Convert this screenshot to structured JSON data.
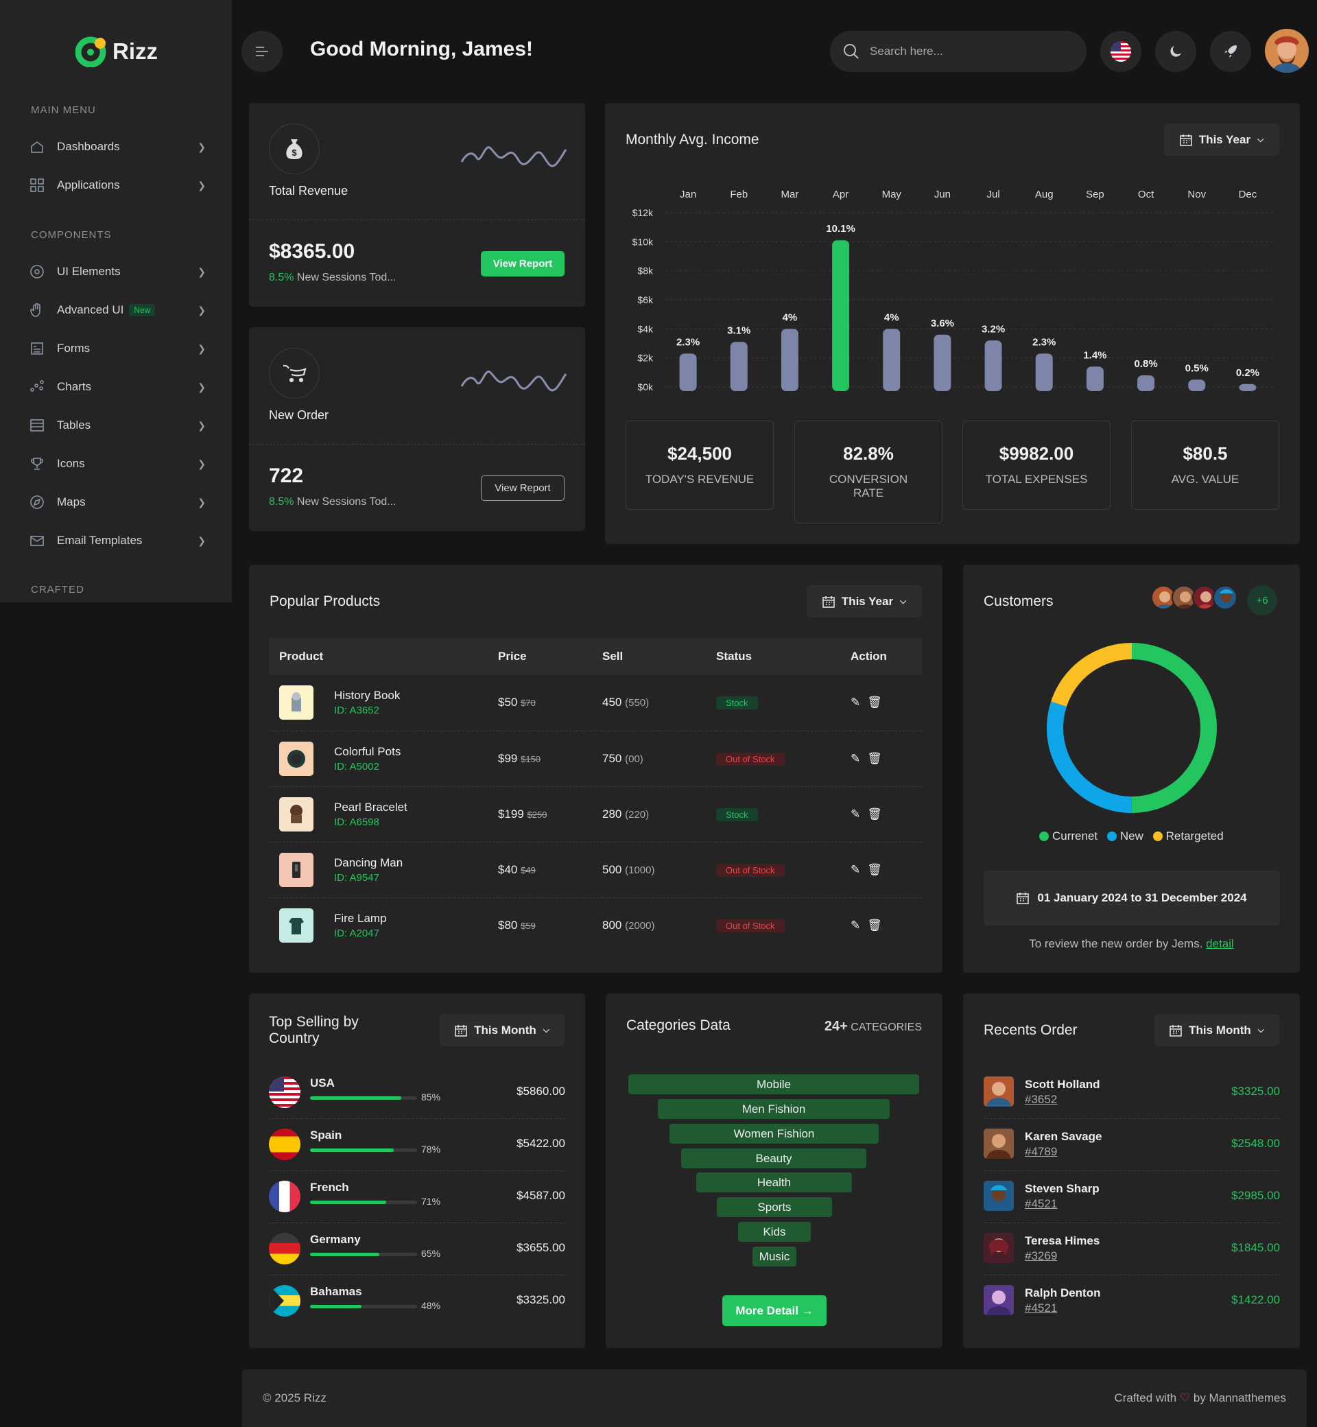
{
  "brand": {
    "name": "Rizz",
    "accent": "#22c55e"
  },
  "sidebar": {
    "main_heading": "Main Menu",
    "components_heading": "Components",
    "crafted_heading": "Crafted",
    "items": [
      {
        "label": "Dashboards",
        "icon": "home-icon"
      },
      {
        "label": "Applications",
        "icon": "grid-icon"
      },
      {
        "label": "UI Elements",
        "icon": "target-icon"
      },
      {
        "label": "Advanced UI",
        "icon": "hand-icon",
        "badge": "New"
      },
      {
        "label": "Forms",
        "icon": "form-icon"
      },
      {
        "label": "Charts",
        "icon": "chart-icon"
      },
      {
        "label": "Tables",
        "icon": "table-icon"
      },
      {
        "label": "Icons",
        "icon": "trophy-icon"
      },
      {
        "label": "Maps",
        "icon": "compass-icon"
      },
      {
        "label": "Email Templates",
        "icon": "mail-icon"
      }
    ]
  },
  "header": {
    "greeting": "Good Morning, James!",
    "search_placeholder": "Search here..."
  },
  "revenue_card": {
    "title": "Total Revenue",
    "value": "$8365.00",
    "pct": "8.5%",
    "sub": "New Sessions Tod...",
    "button": "View Report"
  },
  "order_card": {
    "title": "New Order",
    "value": "722",
    "pct": "8.5%",
    "sub": "New Sessions Tod...",
    "button": "View Report"
  },
  "income": {
    "title": "Monthly Avg. Income",
    "filter": "This Year",
    "stats": [
      {
        "value": "$24,500",
        "label": "Today's Revenue"
      },
      {
        "value": "82.8%",
        "label": "Conversion Rate"
      },
      {
        "value": "$9982.00",
        "label": "Total Expenses"
      },
      {
        "value": "$80.5",
        "label": "Avg. Value"
      }
    ]
  },
  "chart_data": {
    "type": "bar",
    "categories": [
      "Jan",
      "Feb",
      "Mar",
      "Apr",
      "May",
      "Jun",
      "Jul",
      "Aug",
      "Sep",
      "Oct",
      "Nov",
      "Dec"
    ],
    "values": [
      2300,
      3100,
      4000,
      10100,
      4000,
      3600,
      3200,
      2300,
      1400,
      800,
      500,
      200
    ],
    "labels": [
      "2.3%",
      "3.1%",
      "4%",
      "10.1%",
      "4%",
      "3.6%",
      "3.2%",
      "2.3%",
      "1.4%",
      "0.8%",
      "0.5%",
      "0.2%"
    ],
    "y_ticks": [
      "$12k",
      "$10k",
      "$8k",
      "$6k",
      "$4k",
      "$2k",
      "$0k"
    ],
    "ylim": [
      0,
      12000
    ],
    "highlight_index": 3,
    "colors": {
      "default": "#7d86a8",
      "highlight": "#22c55e"
    },
    "grid": true
  },
  "products": {
    "title": "Popular Products",
    "filter": "This Year",
    "columns": [
      "Product",
      "Price",
      "Sell",
      "Status",
      "Action"
    ],
    "rows": [
      {
        "name": "History Book",
        "id": "ID: A3652",
        "price": "$50",
        "old": "$70",
        "sell": "450",
        "sell_total": "(550)",
        "status": "Stock",
        "thumb_bg": "#fdf3c8"
      },
      {
        "name": "Colorful Pots",
        "id": "ID: A5002",
        "price": "$99",
        "old": "$150",
        "sell": "750",
        "sell_total": "(00)",
        "status": "Out of Stock",
        "thumb_bg": "#f8d2b0"
      },
      {
        "name": "Pearl Bracelet",
        "id": "ID: A6598",
        "price": "$199",
        "old": "$250",
        "sell": "280",
        "sell_total": "(220)",
        "status": "Stock",
        "thumb_bg": "#f5e2c8"
      },
      {
        "name": "Dancing Man",
        "id": "ID: A9547",
        "price": "$40",
        "old": "$49",
        "sell": "500",
        "sell_total": "(1000)",
        "status": "Out of Stock",
        "thumb_bg": "#f2c6b0"
      },
      {
        "name": "Fire Lamp",
        "id": "ID: A2047",
        "price": "$80",
        "old": "$59",
        "sell": "800",
        "sell_total": "(2000)",
        "status": "Out of Stock",
        "thumb_bg": "#c4ebe4"
      }
    ]
  },
  "customers": {
    "title": "Customers",
    "more": "+6",
    "legend": [
      {
        "label": "Currenet",
        "color": "#22c55e",
        "share": 0.5
      },
      {
        "label": "New",
        "color": "#0ea5e9",
        "share": 0.3
      },
      {
        "label": "Retargeted",
        "color": "#fbbf24",
        "share": 0.2
      }
    ],
    "date_range": "01 January 2024 to 31 December 2024",
    "note": "To review the new order by Jems.",
    "link": "detail"
  },
  "countries": {
    "title": "Top Selling by Country",
    "filter": "This Month",
    "rows": [
      {
        "name": "USA",
        "pct": "85%",
        "fill": 0.85,
        "amount": "$5860.00"
      },
      {
        "name": "Spain",
        "pct": "78%",
        "fill": 0.78,
        "amount": "$5422.00"
      },
      {
        "name": "French",
        "pct": "71%",
        "fill": 0.71,
        "amount": "$4587.00"
      },
      {
        "name": "Germany",
        "pct": "65%",
        "fill": 0.65,
        "amount": "$3655.00"
      },
      {
        "name": "Bahamas",
        "pct": "48%",
        "fill": 0.48,
        "amount": "$3325.00"
      }
    ]
  },
  "categories": {
    "title": "Categories Data",
    "count": "24+",
    "count_label": "Categories",
    "items": [
      "Mobile",
      "Men Fishion",
      "Women Fishion",
      "Beauty",
      "Health",
      "Sports",
      "Kids",
      "Music"
    ],
    "button": "More Detail →"
  },
  "recent_orders": {
    "title": "Recents Order",
    "filter": "This Month",
    "rows": [
      {
        "name": "Scott Holland",
        "id": "#3652",
        "amount": "$3325.00"
      },
      {
        "name": "Karen Savage",
        "id": "#4789",
        "amount": "$2548.00"
      },
      {
        "name": "Steven Sharp",
        "id": "#4521",
        "amount": "$2985.00"
      },
      {
        "name": "Teresa Himes",
        "id": "#3269",
        "amount": "$1845.00"
      },
      {
        "name": "Ralph Denton",
        "id": "#4521",
        "amount": "$1422.00"
      }
    ]
  },
  "footer": {
    "copyright": "© 2025 Rizz",
    "crafted_prefix": "Crafted with",
    "crafted_suffix": "by Mannatthemes"
  }
}
